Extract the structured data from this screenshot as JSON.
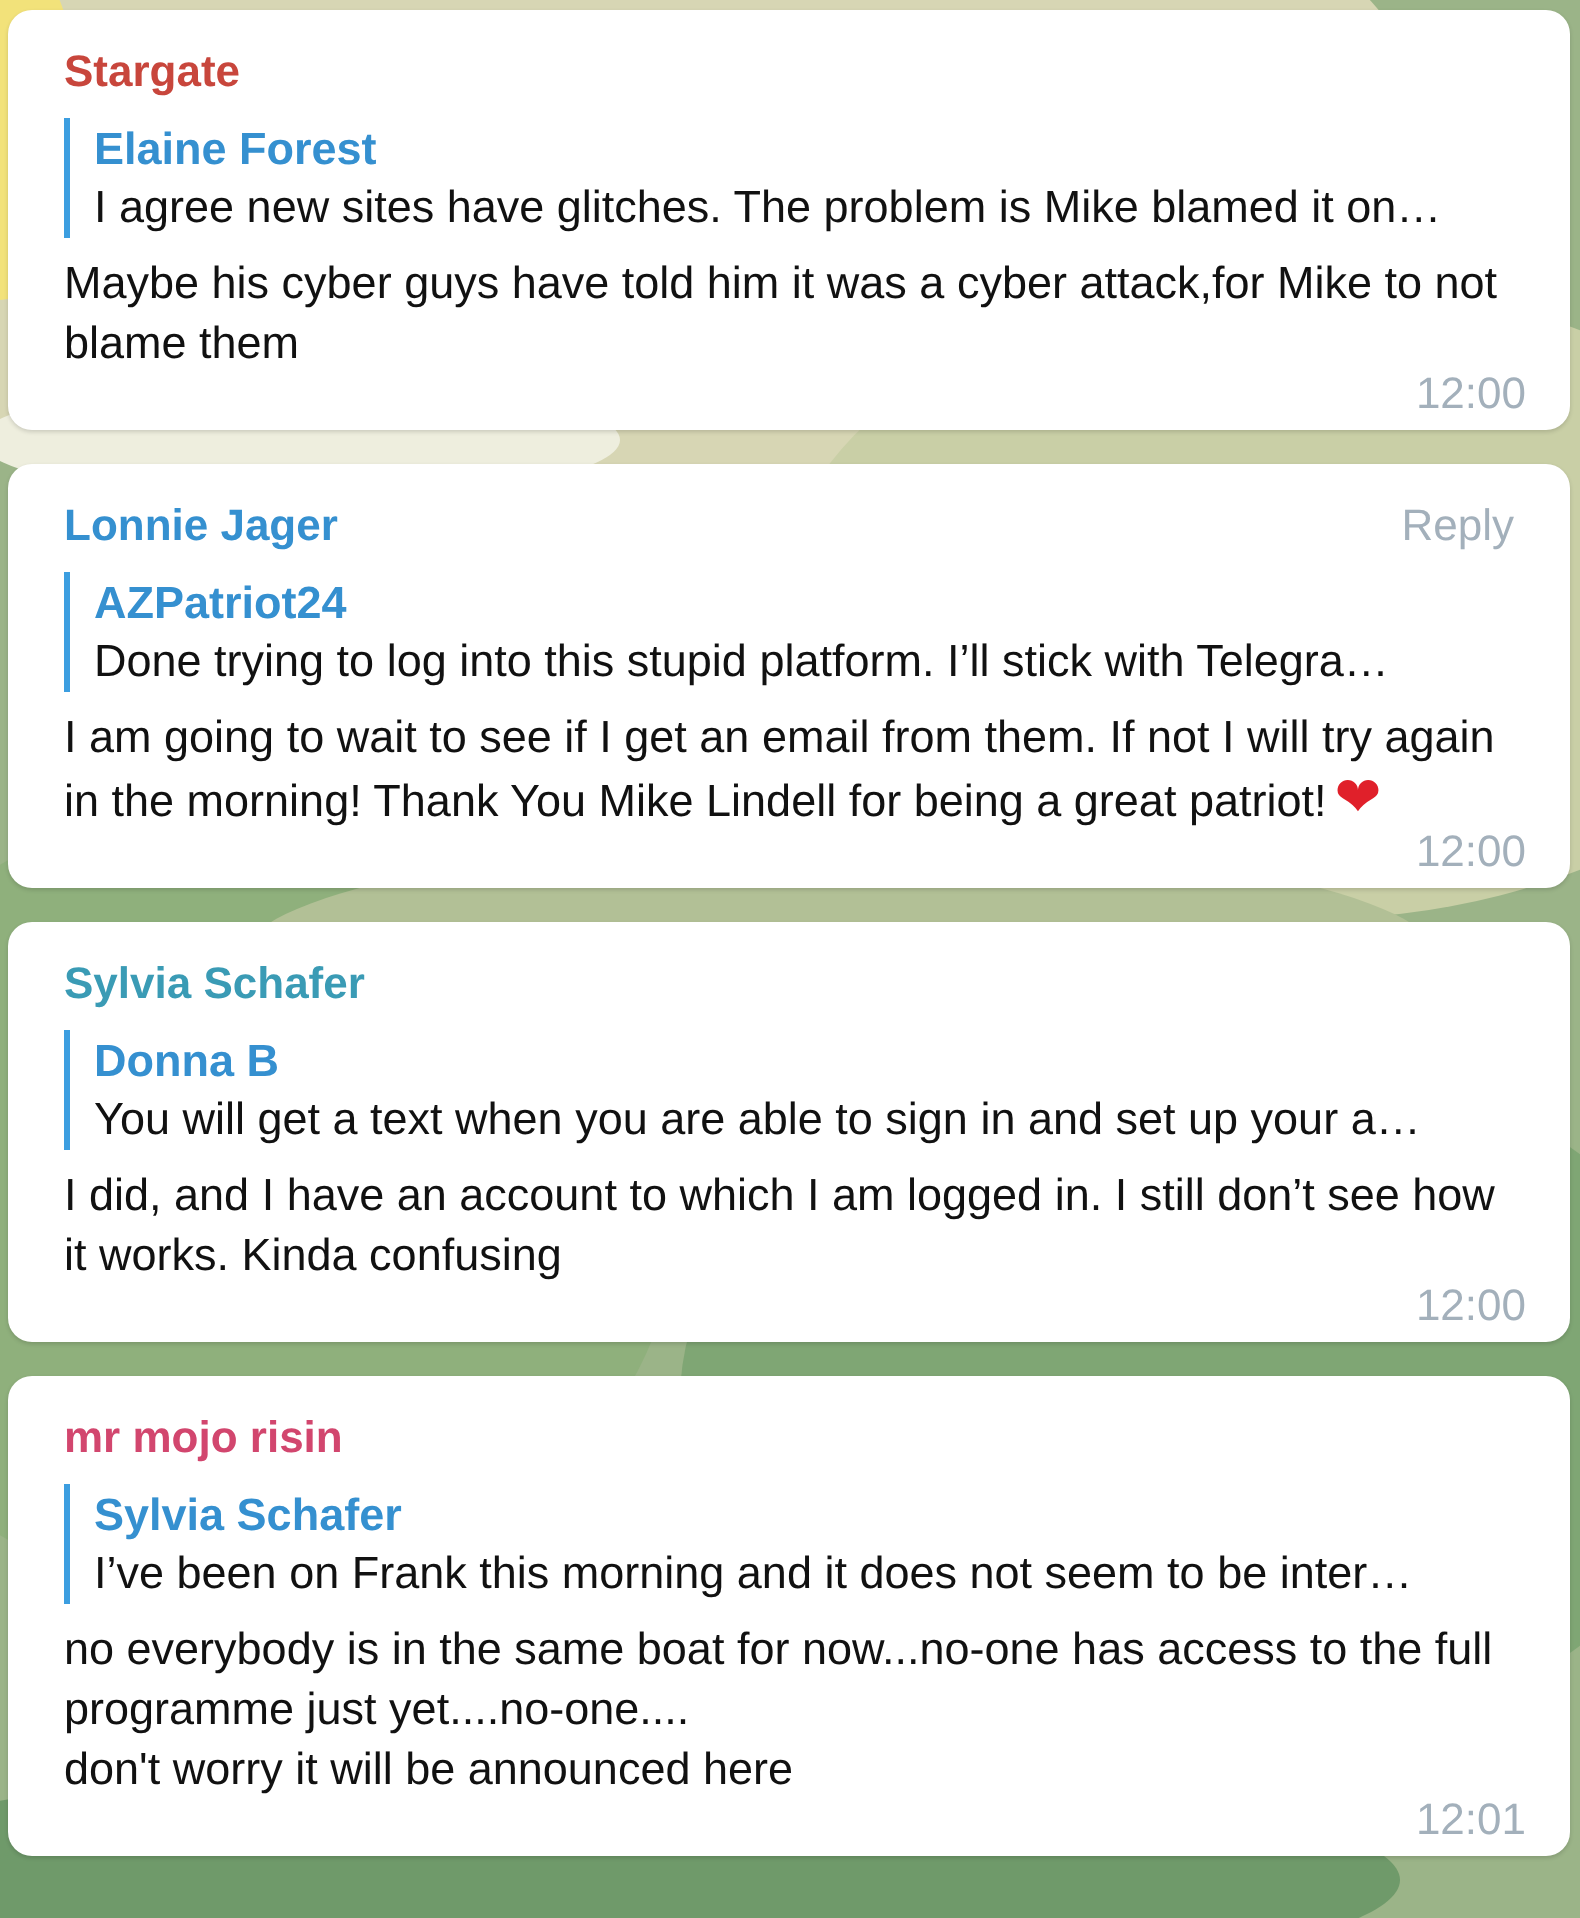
{
  "messages": [
    {
      "sender": "Stargate",
      "color": "#c8463c",
      "reply": {
        "name": "Elaine Forest",
        "text": "I agree new sites have glitches. The problem is Mike blamed it on…"
      },
      "text": "Maybe his cyber guys have told him it was a cyber attack,for Mike to not blame them",
      "time": "12:00"
    },
    {
      "sender": "Lonnie Jager",
      "color": "#3590d0",
      "reply_button": "Reply",
      "reply": {
        "name": "AZPatriot24",
        "text": "Done trying to log into this stupid platform. I’ll stick with Telegra…"
      },
      "text": "I am going to wait to see if I get an email from them. If not I will try again in the morning! Thank You Mike Lindell for being a great patriot!",
      "emoji": "❤",
      "time": "12:00"
    },
    {
      "sender": "Sylvia Schafer",
      "color": "#3a9bb5",
      "reply": {
        "name": "Donna B",
        "text": "You will get a text when you are able to sign in and set up your a…"
      },
      "text": "I did, and I have an account to which I am logged in. I still don’t see how it works. Kinda confusing",
      "time": "12:00"
    },
    {
      "sender": "mr mojo risin",
      "color": "#d2466e",
      "reply": {
        "name": "Sylvia Schafer",
        "text": "I’ve been on Frank this morning and it does not seem to be inter…"
      },
      "text": "no everybody is in the same boat for now...no-one has access to the full programme just yet....no-one....\ndon't worry it will be announced here",
      "time": "12:01"
    }
  ]
}
